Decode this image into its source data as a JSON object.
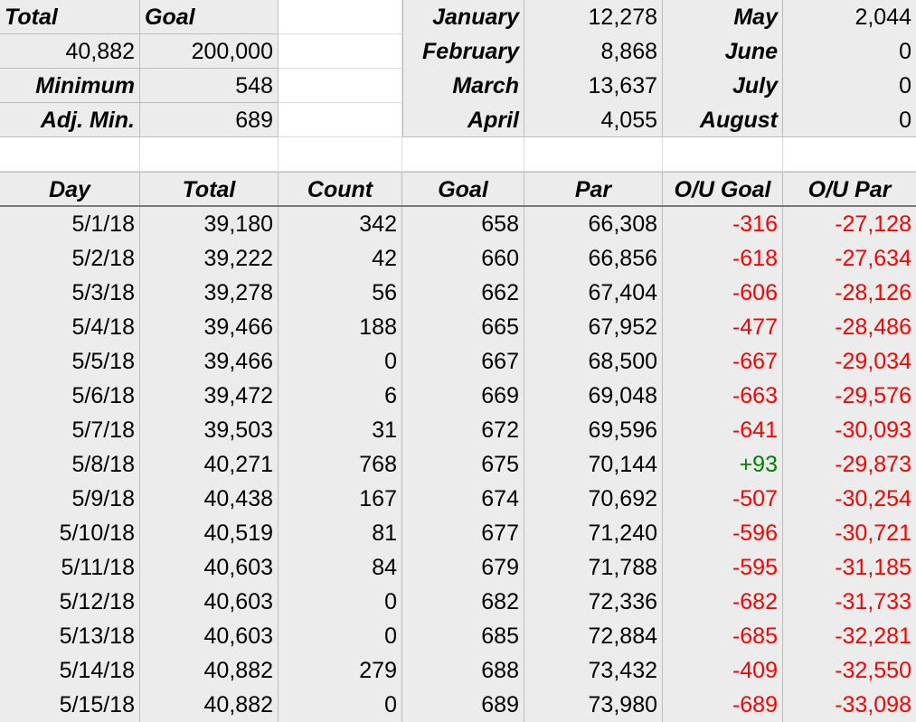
{
  "summary": {
    "total_label": "Total",
    "goal_label": "Goal",
    "total_value": "40,882",
    "goal_value": "200,000",
    "minimum_label": "Minimum",
    "minimum_value": "548",
    "adj_min_label": "Adj. Min.",
    "adj_min_value": "689"
  },
  "months": [
    {
      "name": "January",
      "value": "12,278"
    },
    {
      "name": "February",
      "value": "8,868"
    },
    {
      "name": "March",
      "value": "13,637"
    },
    {
      "name": "April",
      "value": "4,055"
    },
    {
      "name": "May",
      "value": "2,044"
    },
    {
      "name": "June",
      "value": "0"
    },
    {
      "name": "July",
      "value": "0"
    },
    {
      "name": "August",
      "value": "0"
    }
  ],
  "table": {
    "headers": [
      "Day",
      "Total",
      "Count",
      "Goal",
      "Par",
      "O/U Goal",
      "O/U Par"
    ],
    "rows": [
      {
        "day": "5/1/18",
        "total": "39,180",
        "count": "342",
        "goal": "658",
        "par": "66,308",
        "ou_goal": "-316",
        "ou_par": "-27,128"
      },
      {
        "day": "5/2/18",
        "total": "39,222",
        "count": "42",
        "goal": "660",
        "par": "66,856",
        "ou_goal": "-618",
        "ou_par": "-27,634"
      },
      {
        "day": "5/3/18",
        "total": "39,278",
        "count": "56",
        "goal": "662",
        "par": "67,404",
        "ou_goal": "-606",
        "ou_par": "-28,126"
      },
      {
        "day": "5/4/18",
        "total": "39,466",
        "count": "188",
        "goal": "665",
        "par": "67,952",
        "ou_goal": "-477",
        "ou_par": "-28,486"
      },
      {
        "day": "5/5/18",
        "total": "39,466",
        "count": "0",
        "goal": "667",
        "par": "68,500",
        "ou_goal": "-667",
        "ou_par": "-29,034"
      },
      {
        "day": "5/6/18",
        "total": "39,472",
        "count": "6",
        "goal": "669",
        "par": "69,048",
        "ou_goal": "-663",
        "ou_par": "-29,576"
      },
      {
        "day": "5/7/18",
        "total": "39,503",
        "count": "31",
        "goal": "672",
        "par": "69,596",
        "ou_goal": "-641",
        "ou_par": "-30,093"
      },
      {
        "day": "5/8/18",
        "total": "40,271",
        "count": "768",
        "goal": "675",
        "par": "70,144",
        "ou_goal": "+93",
        "ou_par": "-29,873"
      },
      {
        "day": "5/9/18",
        "total": "40,438",
        "count": "167",
        "goal": "674",
        "par": "70,692",
        "ou_goal": "-507",
        "ou_par": "-30,254"
      },
      {
        "day": "5/10/18",
        "total": "40,519",
        "count": "81",
        "goal": "677",
        "par": "71,240",
        "ou_goal": "-596",
        "ou_par": "-30,721"
      },
      {
        "day": "5/11/18",
        "total": "40,603",
        "count": "84",
        "goal": "679",
        "par": "71,788",
        "ou_goal": "-595",
        "ou_par": "-31,185"
      },
      {
        "day": "5/12/18",
        "total": "40,603",
        "count": "0",
        "goal": "682",
        "par": "72,336",
        "ou_goal": "-682",
        "ou_par": "-31,733"
      },
      {
        "day": "5/13/18",
        "total": "40,603",
        "count": "0",
        "goal": "685",
        "par": "72,884",
        "ou_goal": "-685",
        "ou_par": "-32,281"
      },
      {
        "day": "5/14/18",
        "total": "40,882",
        "count": "279",
        "goal": "688",
        "par": "73,432",
        "ou_goal": "-409",
        "ou_par": "-32,550"
      },
      {
        "day": "5/15/18",
        "total": "40,882",
        "count": "0",
        "goal": "689",
        "par": "73,980",
        "ou_goal": "-689",
        "ou_par": "-33,098"
      }
    ]
  },
  "colors": {
    "negative": "#ff0000",
    "positive": "#008000",
    "cell_fill": "#ececec"
  }
}
